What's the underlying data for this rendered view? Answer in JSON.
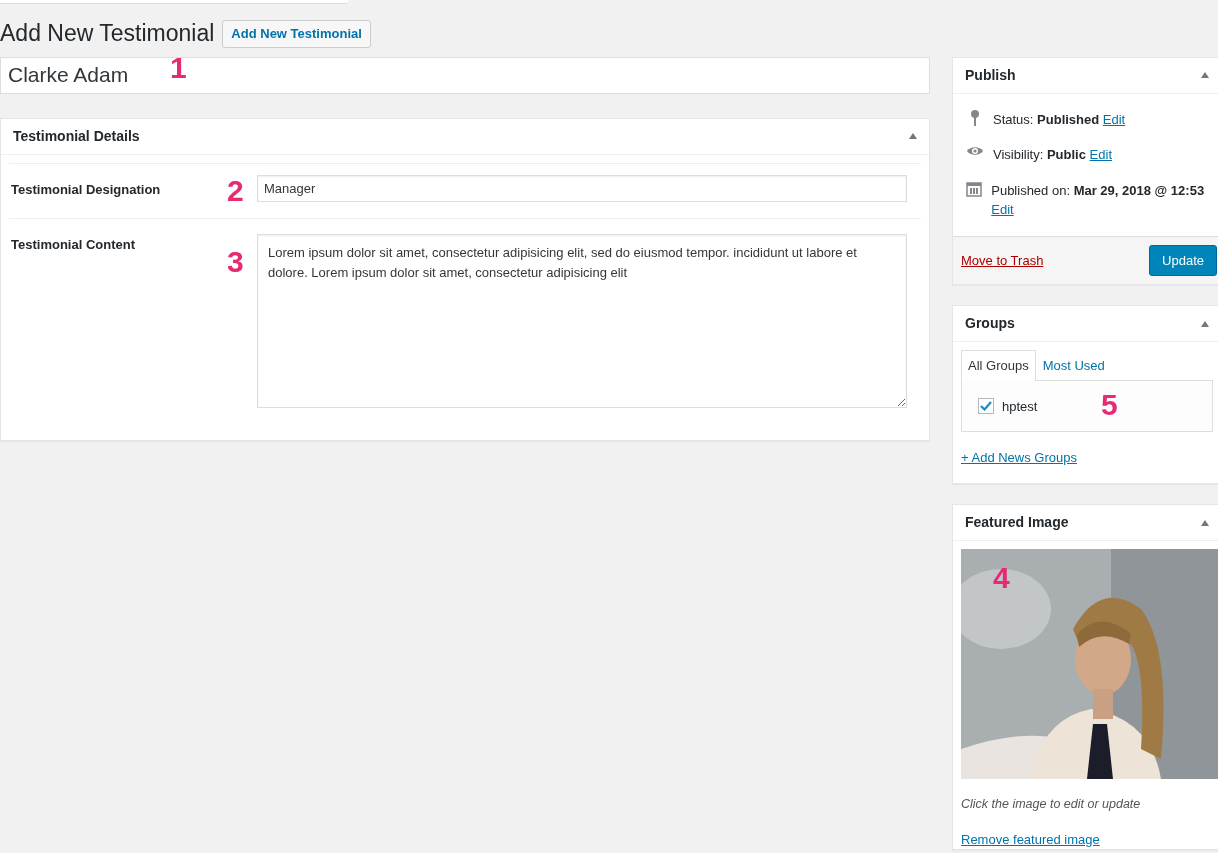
{
  "page_title": "Add New Testimonial",
  "add_button": "Add New Testimonial",
  "title_field": {
    "value": "Clarke Adam",
    "callout": "1"
  },
  "details": {
    "title": "Testimonial Details",
    "expanded": true,
    "fields": [
      {
        "kind": "input",
        "label": "Testimonial Designation",
        "value": "Manager",
        "callout": "2"
      },
      {
        "kind": "textarea",
        "label": "Testimonial Content",
        "value": "Lorem ipsum dolor sit amet, consectetur adipisicing elit, sed do eiusmod tempor. incididunt ut labore et dolore. Lorem ipsum dolor sit amet, consectetur adipisicing elit",
        "callout": "3"
      }
    ]
  },
  "publish": {
    "title": "Publish",
    "expanded": true,
    "rows": [
      {
        "kind": "pin",
        "text": "Status: **Published**",
        "link": "Edit"
      },
      {
        "kind": "eye",
        "text": "Visibility: **Public**",
        "link": "Edit"
      },
      {
        "kind": "calendar",
        "text": "Published on: **Mar 29, 2018 @ 12:53**",
        "link": "Edit"
      }
    ],
    "trash": "Move to Trash",
    "update": "Update"
  },
  "groups": {
    "title": "Groups",
    "expanded": true,
    "tabs": [
      {
        "label": "All Groups",
        "selected": true
      },
      {
        "label": "Most Used",
        "selected": false
      }
    ],
    "items": [
      {
        "label": "hptest",
        "checked": true
      }
    ],
    "callout": "5",
    "add_link": "+ Add News Groups"
  },
  "featured": {
    "title": "Featured Image",
    "expanded": true,
    "callout": "4",
    "hint": "Click the image to edit or update",
    "remove": "Remove featured image"
  }
}
